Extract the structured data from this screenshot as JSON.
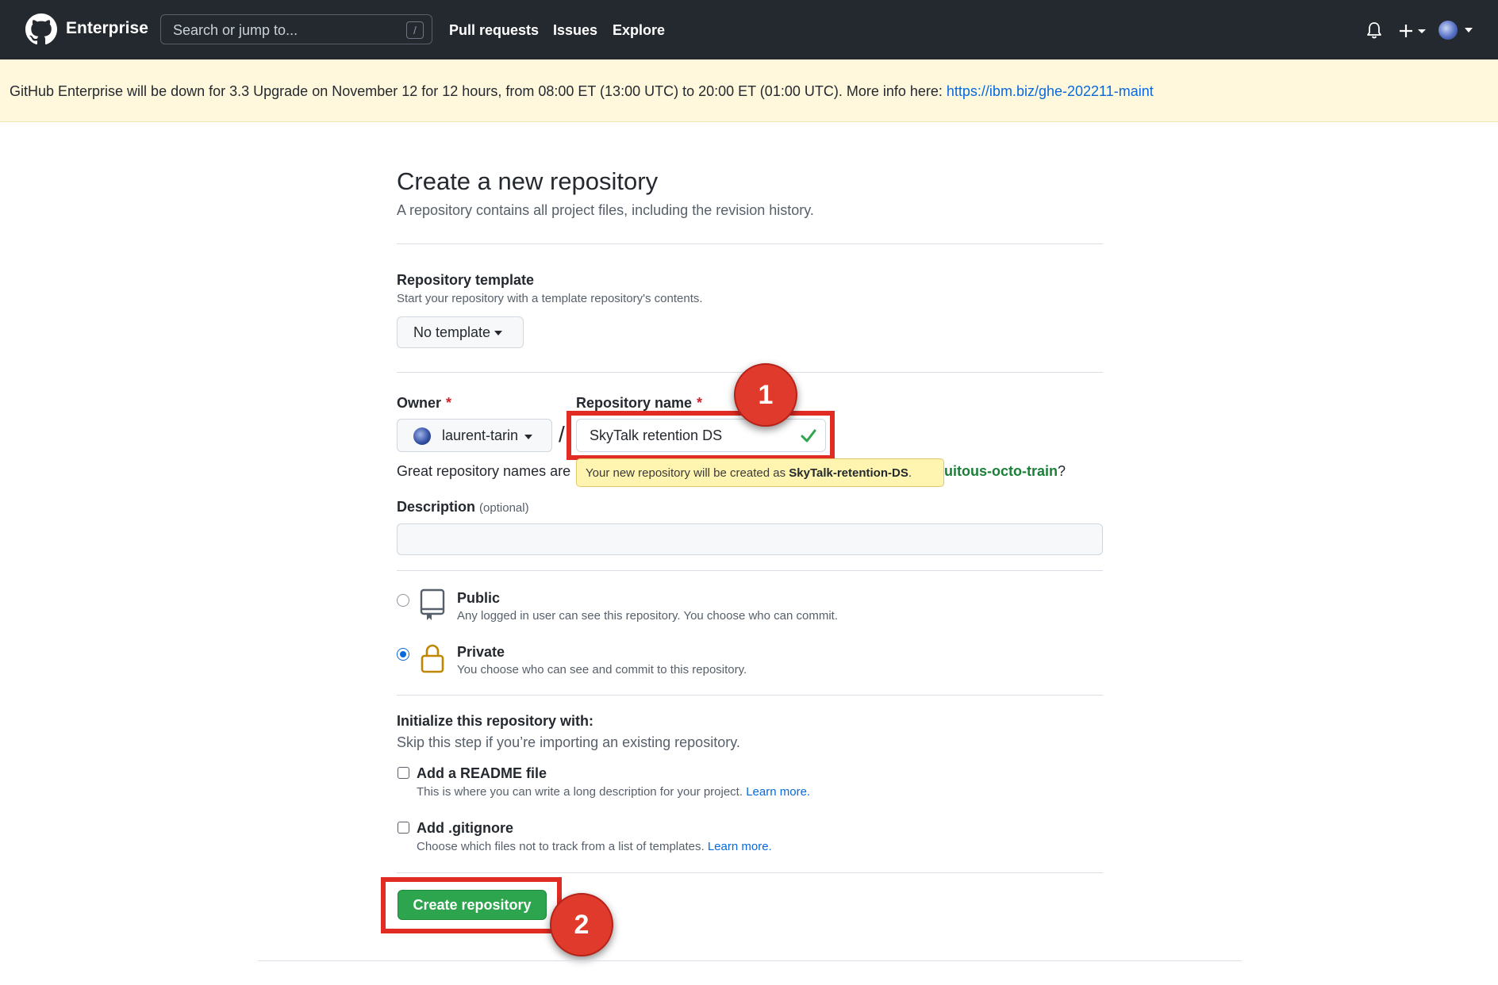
{
  "header": {
    "brand": "Enterprise",
    "search_placeholder": "Search or jump to...",
    "search_shortcut": "/",
    "nav": [
      "Pull requests",
      "Issues",
      "Explore"
    ]
  },
  "banner": {
    "text": "GitHub Enterprise will be down for 3.3 Upgrade on November 12 for 12 hours, from 08:00 ET (13:00 UTC) to 20:00 ET (01:00 UTC). More info here: ",
    "link": "https://ibm.biz/ghe-202211-maint"
  },
  "page": {
    "title": "Create a new repository",
    "lead": "A repository contains all project files, including the revision history."
  },
  "template": {
    "label": "Repository template",
    "note": "Start your repository with a template repository's contents.",
    "button": "No template"
  },
  "owner": {
    "label": "Owner",
    "required_mark": "*",
    "value": "laurent-tarin"
  },
  "repo_name": {
    "label": "Repository name",
    "required_mark": "*",
    "value": "SkyTalk retention DS",
    "separator": "/"
  },
  "hint": {
    "prefix": "Great repository names are",
    "tooltip_prefix": "Your new repository will be created as ",
    "tooltip_name": "SkyTalk-retention-DS",
    "tooltip_suffix": ".",
    "suggestion": "uitous-octo-train",
    "suffix": "?"
  },
  "description": {
    "label": "Description",
    "optional": "(optional)",
    "value": ""
  },
  "visibility": {
    "selected": "private",
    "public": {
      "title": "Public",
      "desc": "Any logged in user can see this repository. You choose who can commit."
    },
    "private": {
      "title": "Private",
      "desc": "You choose who can see and commit to this repository."
    }
  },
  "init": {
    "title": "Initialize this repository with:",
    "note": "Skip this step if you’re importing an existing repository.",
    "readme": {
      "label": "Add a README file",
      "desc": "This is where you can write a long description for your project.",
      "link": "Learn more.",
      "checked": false
    },
    "gitignore": {
      "label": "Add .gitignore",
      "desc": "Choose which files not to track from a list of templates.",
      "link": "Learn more.",
      "checked": false
    }
  },
  "submit": {
    "label": "Create repository"
  },
  "annotations": {
    "badge1": "1",
    "badge2": "2"
  },
  "colors": {
    "annotation": "#e02c22",
    "primary_button": "#2da44e",
    "banner_bg": "#fff8dc"
  }
}
